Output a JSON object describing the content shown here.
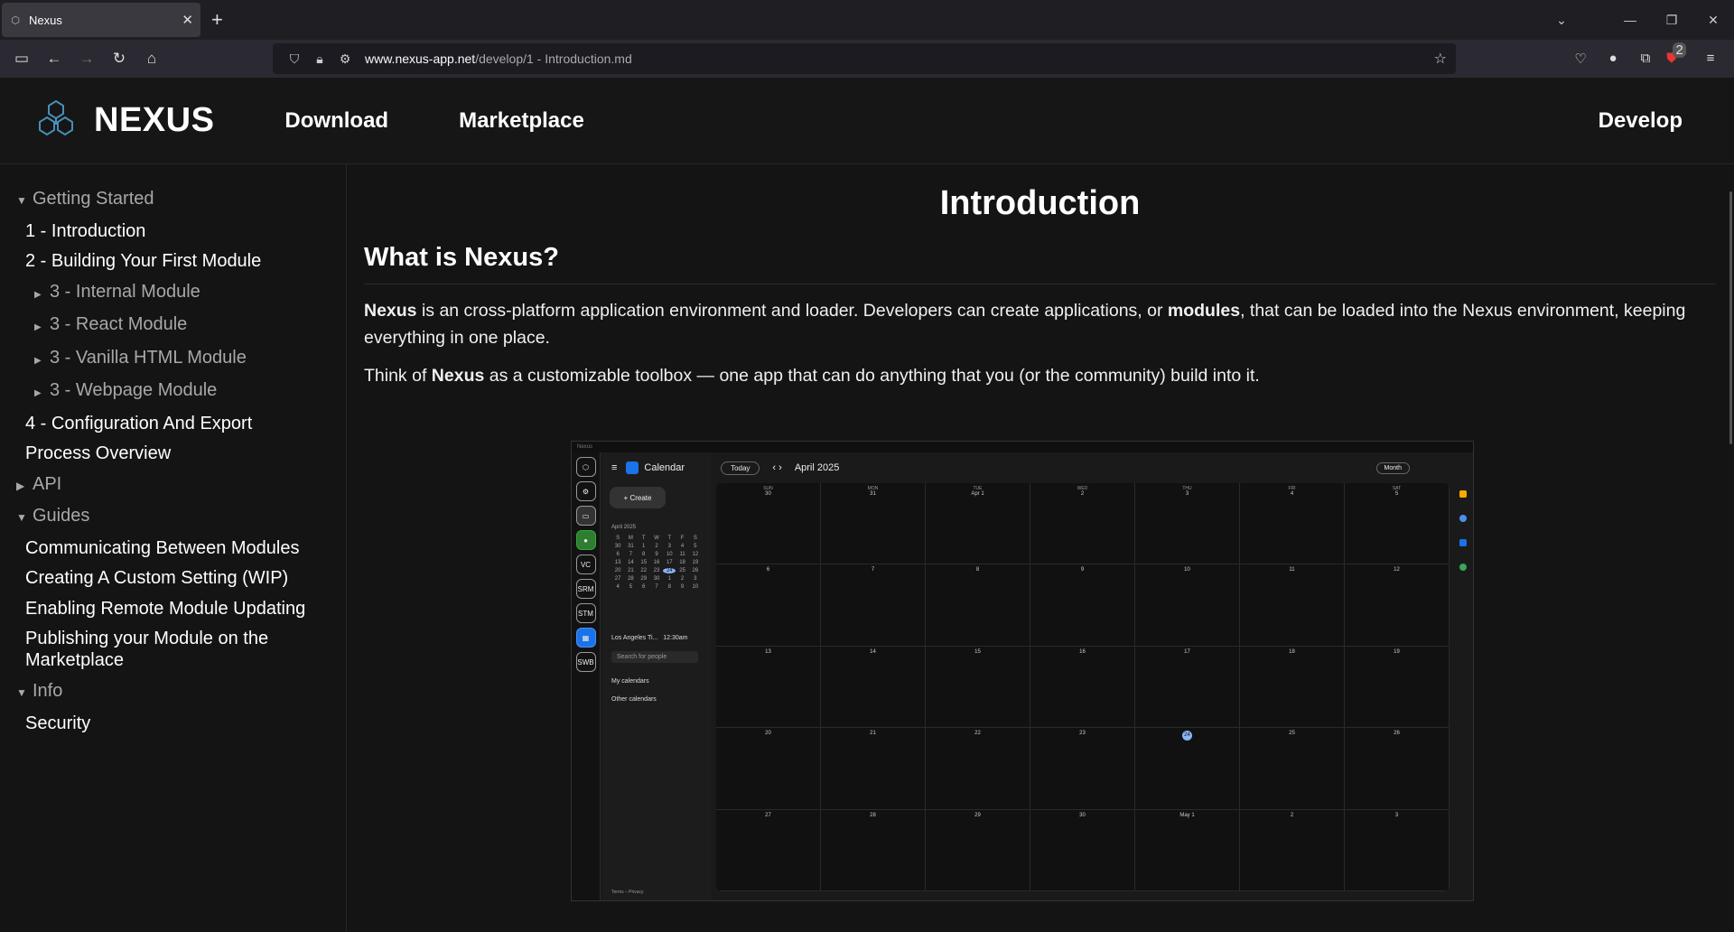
{
  "browser": {
    "tab_title": "Nexus",
    "url_domain": "www.nexus-app.net",
    "url_path": "/develop/1 - Introduction.md",
    "extension_badge": "2"
  },
  "header": {
    "brand": "NEXUS",
    "nav": [
      "Download",
      "Marketplace"
    ],
    "nav_right": "Develop"
  },
  "sidebar": {
    "getting_started": "Getting Started",
    "items": [
      "1 - Introduction",
      "2 - Building Your First Module",
      "3 - Internal Module",
      "3 - React Module",
      "3 - Vanilla HTML Module",
      "3 - Webpage Module",
      "4 - Configuration And Export",
      "Process Overview"
    ],
    "api": "API",
    "guides": "Guides",
    "guide_items": [
      "Communicating Between Modules",
      "Creating A Custom Setting (WIP)",
      "Enabling Remote Module Updating",
      "Publishing your Module on the Marketplace"
    ],
    "info": "Info",
    "info_items": [
      "Security"
    ]
  },
  "content": {
    "title": "Introduction",
    "h2": "What is Nexus?",
    "p1_a": "Nexus",
    "p1_b": " is an cross-platform application environment and loader. Developers can create applications, or ",
    "p1_c": "modules",
    "p1_d": ", that can be loaded into the Nexus environment, keeping everything in one place.",
    "p2_a": "Think of ",
    "p2_b": "Nexus",
    "p2_c": " as a customizable toolbox — one app that can do anything that you (or the community) build into it."
  },
  "screenshot": {
    "window_title": "Nexus",
    "app_name": "Calendar",
    "today": "Today",
    "month_title": "April 2025",
    "view": "Month",
    "create": "Create",
    "mini_title": "April 2025",
    "timezone": "Los Angeles Ti...",
    "time": "12:30am",
    "search_people": "Search for people",
    "my_calendars": "My calendars",
    "other_calendars": "Other calendars",
    "footer": "Terms – Privacy",
    "rail": [
      "VC",
      "SRM",
      "STM",
      "SWB"
    ],
    "dows": [
      "SUN",
      "MON",
      "TUE",
      "WED",
      "THU",
      "FRI",
      "SAT"
    ],
    "days": [
      "30",
      "31",
      "Apr 1",
      "2",
      "3",
      "4",
      "5",
      "6",
      "7",
      "8",
      "9",
      "10",
      "11",
      "12",
      "13",
      "14",
      "15",
      "16",
      "17",
      "18",
      "19",
      "20",
      "21",
      "22",
      "23",
      "24",
      "25",
      "26",
      "27",
      "28",
      "29",
      "30",
      "May 1",
      "2",
      "3"
    ],
    "today_day": "24",
    "mini_dows": [
      "S",
      "M",
      "T",
      "W",
      "T",
      "F",
      "S"
    ],
    "mini_days": [
      "30",
      "31",
      "1",
      "2",
      "3",
      "4",
      "5",
      "6",
      "7",
      "8",
      "9",
      "10",
      "11",
      "12",
      "13",
      "14",
      "15",
      "16",
      "17",
      "18",
      "19",
      "20",
      "21",
      "22",
      "23",
      "24",
      "25",
      "26",
      "27",
      "28",
      "29",
      "30",
      "1",
      "2",
      "3",
      "4",
      "5",
      "6",
      "7",
      "8",
      "9",
      "10"
    ]
  }
}
